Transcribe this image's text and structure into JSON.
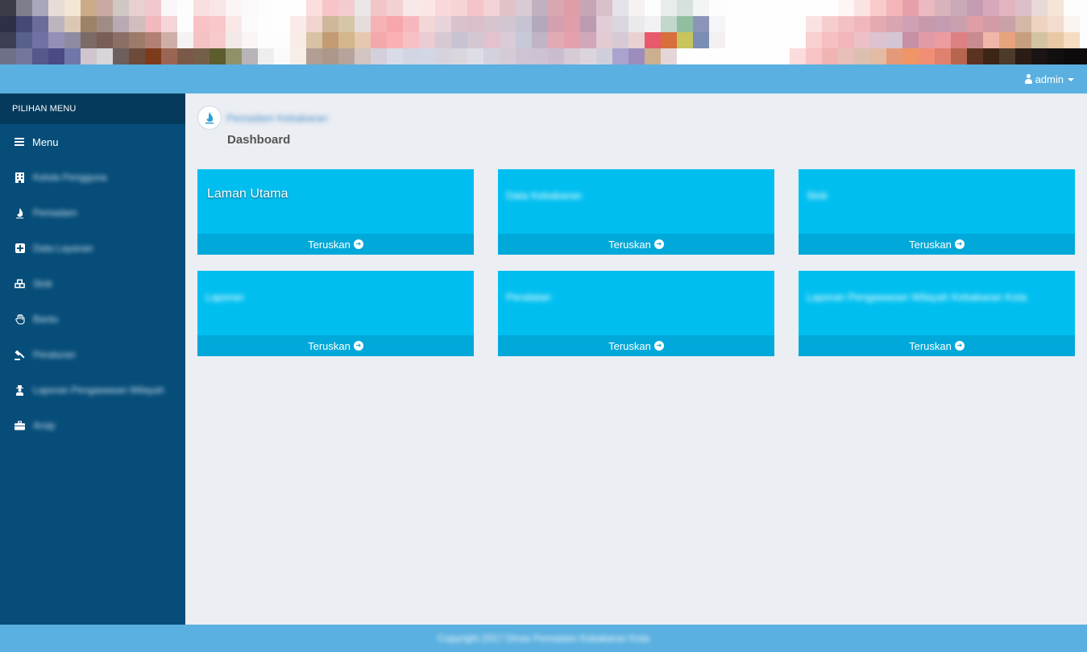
{
  "banner": {
    "rows": [
      [
        "#3a3c48",
        "#7d7f8d",
        "#a7a9bb",
        "#e7dcd8",
        "#f3e6d3",
        "#cbab88",
        "#c9aaa2",
        "#d0c7c4",
        "#e8d0d0",
        "#f2c8ce",
        "#fbf7f8",
        "#fdfdfd",
        "#f8dede",
        "#f8e5e5",
        "#fcf5f5",
        "#fbf9f9",
        "#fdfdfd",
        "#fefefe",
        "#fefefe",
        "#fbdede",
        "#f8c4c6",
        "#f3ccd0",
        "#ebe7e6",
        "#f2c6c8",
        "#f2d1d2",
        "#f9e8e9",
        "#fbe6e5",
        "#f8d8da",
        "#f6d4d4",
        "#f5c4c8",
        "#f1d2d7",
        "#e2c2c8",
        "#d8cbd4",
        "#c1b1c0",
        "#d8a7b1",
        "#de9da7",
        "#c6a6b6",
        "#d9bfc8",
        "#e5e3ea",
        "#f6f2f2",
        "#fdfdfd",
        "#e8ecec",
        "#d6e1de",
        "#f3f5f5",
        "#fdfdfd",
        "#fefefe",
        "#fefefe",
        "#fefefe",
        "#fefefe",
        "#fefefe",
        "#fefefe",
        "#fefefe",
        "#fef5f5",
        "#fce3e3",
        "#f9cbcb",
        "#f3b5b8",
        "#e7a0aa",
        "#ecb9c0",
        "#d9b3bb",
        "#c9a8b8",
        "#c49bb1",
        "#d6a9ba",
        "#e2b4bf",
        "#dcbfc8",
        "#e6d9d6",
        "#f5e5d6",
        "#fdfdfd",
        "#fdfdfd"
      ],
      [
        "#2d3046",
        "#464876",
        "#6b6c9c",
        "#bcb5bf",
        "#dcc7b5",
        "#9e8268",
        "#a08c85",
        "#b9a9b2",
        "#d2bdbe",
        "#f1b8bd",
        "#f5d5d7",
        "#fdfdfd",
        "#fbc2c5",
        "#f9c6c9",
        "#fae8e8",
        "#fcfbfb",
        "#fdfdfd",
        "#fefefe",
        "#fbeaea",
        "#f0d5cf",
        "#cfb79b",
        "#d5c6a7",
        "#e6dcdc",
        "#f5b3b6",
        "#f7a6aa",
        "#f7b8bd",
        "#f3d6d8",
        "#e7d4db",
        "#d9c2cd",
        "#d8bfcb",
        "#d6c4ce",
        "#d1c6d1",
        "#c7c3d2",
        "#b4a8bc",
        "#d3a0b0",
        "#e09eaa",
        "#bb9cb1",
        "#e2cdd7",
        "#d9d6e0",
        "#eaeaec",
        "#f1f1f3",
        "#c3d7cb",
        "#8fbf9f",
        "#8c94b8",
        "#f5f4f6",
        "#fefefe",
        "#fefefe",
        "#fefefe",
        "#fefefe",
        "#fefefe",
        "#fbe2e2",
        "#f6cdcd",
        "#f3c1c3",
        "#f0b7bb",
        "#e5a9b0",
        "#d8a5b1",
        "#d0a1b4",
        "#c799ad",
        "#c49bb1",
        "#ca9fae",
        "#df9ea6",
        "#d39ba5",
        "#c9a2a7",
        "#d4b7a7",
        "#edd3c0",
        "#f3dccd",
        "#fbf3ee",
        "#fdfdfd"
      ],
      [
        "#3d3f54",
        "#58608c",
        "#7271a5",
        "#9390b7",
        "#8e8aa2",
        "#7c6a66",
        "#795e56",
        "#8b6f66",
        "#9e7a69",
        "#b27f74",
        "#cfaea8",
        "#f4f2f2",
        "#f5c2c4",
        "#f7c9ca",
        "#f3e9e8",
        "#f9f6f5",
        "#fdfdfd",
        "#fdfdfd",
        "#f7ece6",
        "#d8c2a5",
        "#c39c73",
        "#d3b68c",
        "#e5c9ae",
        "#f5a8ab",
        "#fbb1b4",
        "#f6c0c4",
        "#eacdd4",
        "#d7c9d4",
        "#c8c3d3",
        "#d3c8d2",
        "#e3c2cd",
        "#dacbd6",
        "#c5c9d9",
        "#bfb5c7",
        "#e1aab5",
        "#e4a1ad",
        "#d0a8ba",
        "#e2cbd3",
        "#d8cad4",
        "#e9d0d2",
        "#e7596b",
        "#d86e39",
        "#c7c55c",
        "#7a8db3",
        "#f4f0f2",
        "#fefefe",
        "#fefefe",
        "#fefefe",
        "#fefefe",
        "#fefefe",
        "#f8d0d0",
        "#f7bfc1",
        "#f2b5b9",
        "#ecc0c6",
        "#dcc3cf",
        "#d5c5d3",
        "#c690a6",
        "#e29aa7",
        "#ec9b9f",
        "#dc8082",
        "#c98b8f",
        "#f0b6a9",
        "#e7a37b",
        "#c89f7e",
        "#d2c3a3",
        "#e8c8a5",
        "#f6dcc0",
        "#fdfdfd"
      ],
      [
        "#6f718b",
        "#74769c",
        "#55588b",
        "#4b4a85",
        "#7177a8",
        "#d0c5cf",
        "#d8d6db",
        "#6c5f5d",
        "#6c4b3a",
        "#7d3b1c",
        "#9c6553",
        "#7b5948",
        "#74604a",
        "#5d5c2c",
        "#8f9169",
        "#b8b4b7",
        "#eeeeef",
        "#fafafa",
        "#f5efe7",
        "#b19f95",
        "#ad968a",
        "#b6a39c",
        "#d1c4c1",
        "#d3d0db",
        "#d9dbe8",
        "#d2d5e4",
        "#d3d6e5",
        "#d6d3df",
        "#dad6de",
        "#dddde6",
        "#d3d1dd",
        "#d3ccd7",
        "#cdc3d2",
        "#cdc2d3",
        "#cabdcf",
        "#d6cad6",
        "#dcd4dd",
        "#cfcfdb",
        "#a9a3ce",
        "#9c8dbd",
        "#cab08e",
        "#e4d6d8",
        "#fdfdfd",
        "#fefefe",
        "#fefefe",
        "#fefefe",
        "#fefefe",
        "#fefefe",
        "#fefefe",
        "#fbdcdc",
        "#f8c4c6",
        "#f0b4b4",
        "#e9bfb9",
        "#dbc0b2",
        "#e2bba2",
        "#e49a78",
        "#ef9566",
        "#f28e74",
        "#e0806e",
        "#b8654d",
        "#5b3421",
        "#3d2516",
        "#4c3a2a",
        "#2b1d16",
        "#1a1414",
        "#120f10",
        "#0d0b0c",
        "#0d0c0c"
      ]
    ]
  },
  "navbar": {
    "user_label": "admin"
  },
  "sidebar": {
    "header": "PILIHAN MENU",
    "menu_label": "Menu",
    "items": [
      {
        "icon": "building-icon",
        "label": "Kelola Pengguna"
      },
      {
        "icon": "flame-icon",
        "label": "Pemadam"
      },
      {
        "icon": "plus-square-icon",
        "label": "Data Layanan"
      },
      {
        "icon": "cubes-icon",
        "label": "Stok"
      },
      {
        "icon": "hand-icon",
        "label": "Bantu"
      },
      {
        "icon": "gavel-icon",
        "label": "Peraturan"
      },
      {
        "icon": "user-secret-icon",
        "label": "Laporan Pengawasan Wilayah"
      },
      {
        "icon": "briefcase-icon",
        "label": "Arsip"
      }
    ]
  },
  "main": {
    "brand_name": "Pemadam Kebakaran",
    "page_title": "Dashboard",
    "tiles": [
      {
        "title": "Laman Utama",
        "blurred": false,
        "footer": "Teruskan"
      },
      {
        "title": "Data Kebakaran",
        "blurred": true,
        "footer": "Teruskan"
      },
      {
        "title": "Stok",
        "blurred": true,
        "footer": "Teruskan"
      },
      {
        "title": "Laporan",
        "blurred": true,
        "footer": "Teruskan"
      },
      {
        "title": "Peralatan",
        "blurred": true,
        "footer": "Teruskan"
      },
      {
        "title": "Laporan Pengawasan Wilayah Kebakaran Kota",
        "blurred": true,
        "footer": "Teruskan"
      }
    ]
  },
  "footer": {
    "text": "Copyright 2017 Dinas Pemadam Kebakaran Kota"
  }
}
